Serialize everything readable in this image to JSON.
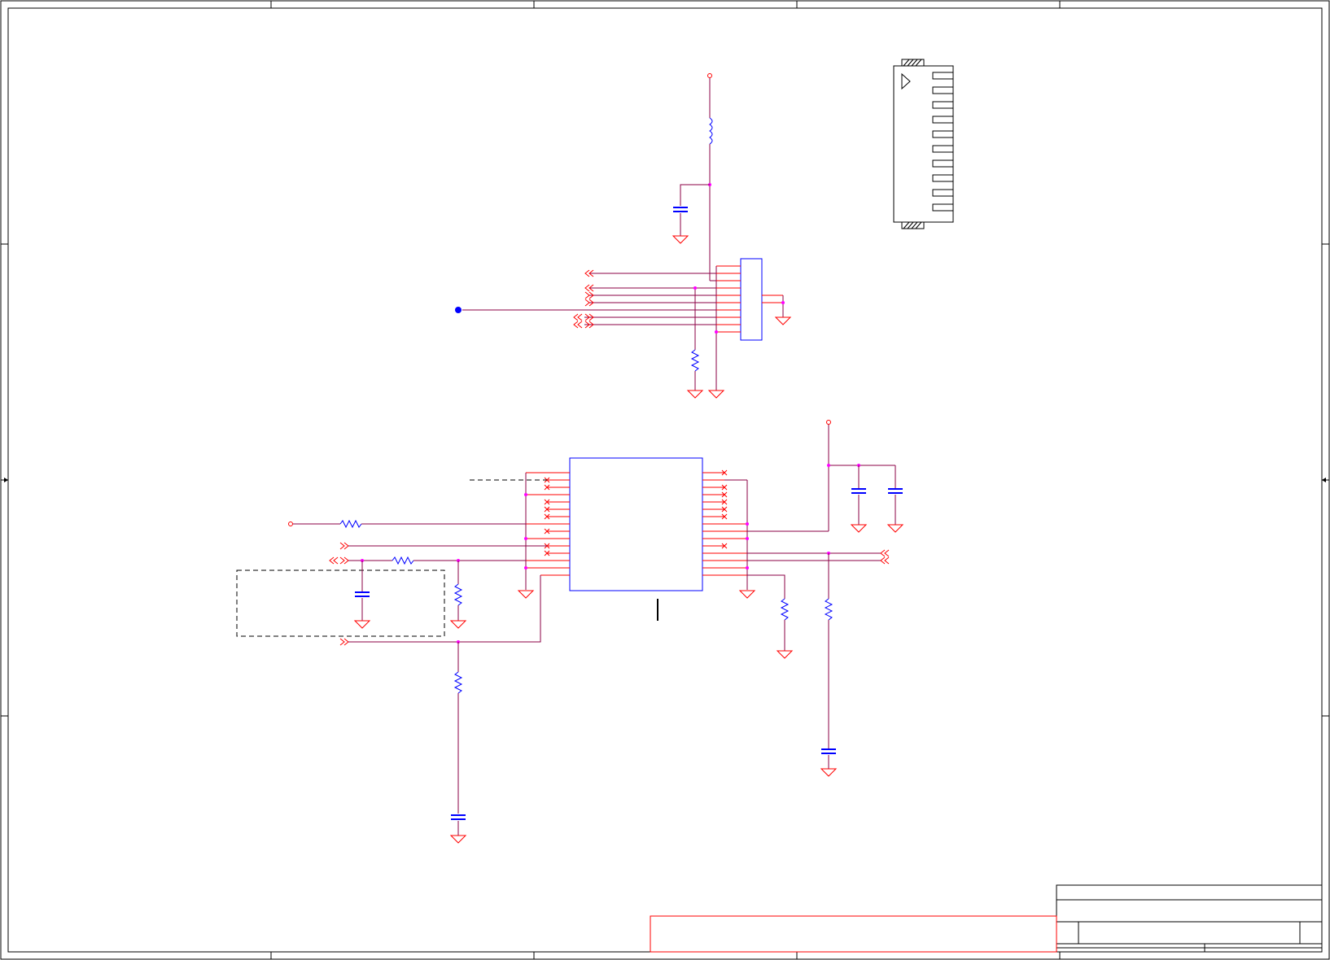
{
  "sheet": {
    "title": "",
    "colors": {
      "wire": "#8b0046",
      "pin": "#ff0000",
      "power": "#ff0000",
      "component": "#0000ff",
      "junction": "#ff00ff",
      "frame": "#000000",
      "note_box": "#ff0000"
    }
  },
  "symbols": {
    "ground": "ground-icon",
    "power_port": "power-port-icon",
    "resistor": "resistor-icon",
    "inductor": "inductor-icon",
    "capacitor": "capacitor-icon",
    "connector": "fpc-connector-icon",
    "ic": "ic-block-icon",
    "offsheet": "offsheet-arrow-icon",
    "no_connect": "no-connect-icon"
  }
}
